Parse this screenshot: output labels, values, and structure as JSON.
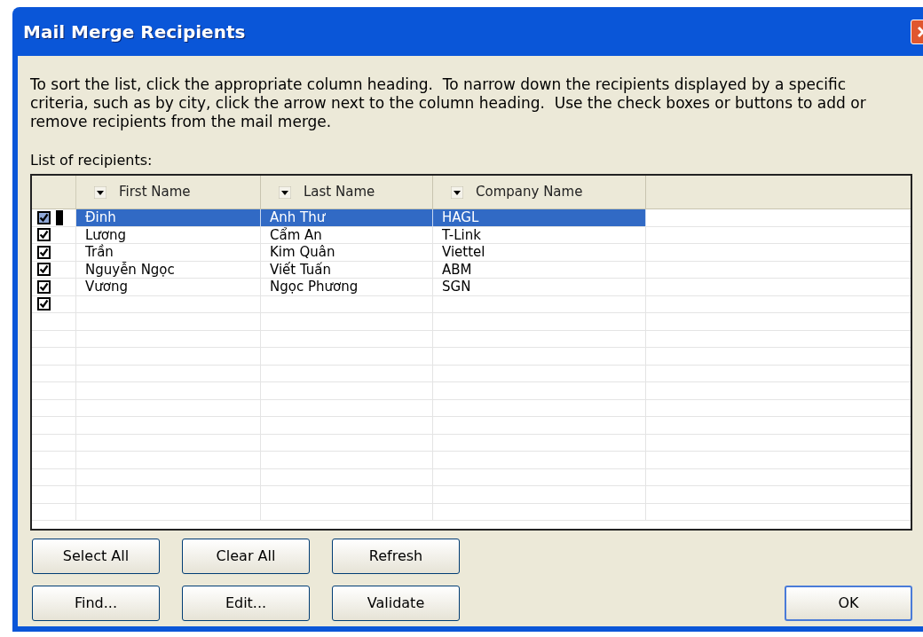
{
  "window": {
    "title": "Mail Merge Recipients"
  },
  "instructions": "To sort the list, click the appropriate column heading.  To narrow down the recipients displayed by a specific criteria, such as by city, click the arrow next to the column heading.  Use the check boxes or buttons to add or remove recipients from the mail merge.",
  "list_label": {
    "text": "List of recipients:"
  },
  "table": {
    "columns": [
      "First Name",
      "Last Name",
      "Company Name"
    ],
    "rows": [
      {
        "checked": true,
        "selected": true,
        "cells": [
          "Đinh",
          "Anh Thư",
          "HAGL"
        ]
      },
      {
        "checked": true,
        "selected": false,
        "cells": [
          "Lương",
          "Cẩm An",
          "T-Link"
        ]
      },
      {
        "checked": true,
        "selected": false,
        "cells": [
          "Trần",
          "Kim Quân",
          "Viettel"
        ]
      },
      {
        "checked": true,
        "selected": false,
        "cells": [
          "Nguyễn Ngọc",
          "Viết Tuấn",
          "ABM"
        ]
      },
      {
        "checked": true,
        "selected": false,
        "cells": [
          "Vương",
          "Ngọc Phương",
          "SGN"
        ]
      },
      {
        "checked": true,
        "selected": false
      }
    ]
  },
  "buttons": [
    [
      {
        "label": "Select All"
      },
      {
        "label": "Clear All"
      },
      {
        "label": "Refresh"
      }
    ],
    [
      {
        "label": "Find..."
      },
      {
        "label": "Edit..."
      },
      {
        "label": "Validate"
      }
    ]
  ],
  "ok_button": {
    "label": "OK"
  }
}
